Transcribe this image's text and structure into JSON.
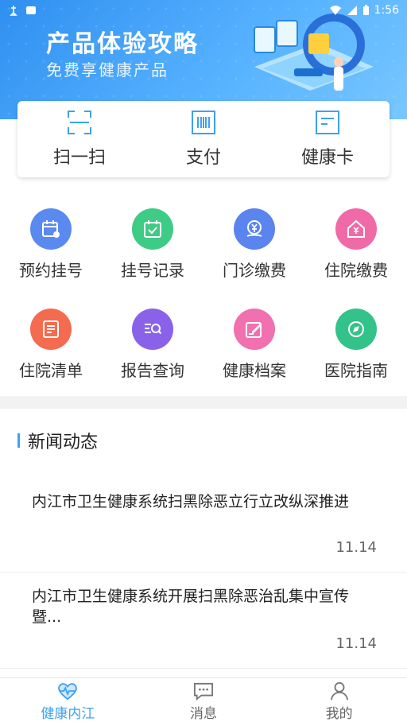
{
  "status_bar": {
    "time": "1:56"
  },
  "banner": {
    "title": "产品体验攻略",
    "subtitle": "免费享健康产品"
  },
  "quick_actions": [
    {
      "label": "扫一扫",
      "icon": "scan-icon"
    },
    {
      "label": "支付",
      "icon": "barcode-icon"
    },
    {
      "label": "健康卡",
      "icon": "card-icon"
    }
  ],
  "services": [
    {
      "label": "预约挂号",
      "icon": "calendar-icon",
      "color": "#5a8af0"
    },
    {
      "label": "挂号记录",
      "icon": "calendar-check-icon",
      "color": "#3ecb86"
    },
    {
      "label": "门诊缴费",
      "icon": "yen-coin-icon",
      "color": "#5a84ee"
    },
    {
      "label": "住院缴费",
      "icon": "yen-house-icon",
      "color": "#f06aa8"
    },
    {
      "label": "住院清单",
      "icon": "list-icon",
      "color": "#f56b4f"
    },
    {
      "label": "报告查询",
      "icon": "report-search-icon",
      "color": "#8a62ea"
    },
    {
      "label": "健康档案",
      "icon": "edit-record-icon",
      "color": "#f070b0"
    },
    {
      "label": "医院指南",
      "icon": "compass-icon",
      "color": "#33c28a"
    }
  ],
  "news": {
    "heading": "新闻动态",
    "items": [
      {
        "title": "内江市卫生健康系统扫黑除恶立行立改纵深推进",
        "date": "11.14"
      },
      {
        "title": "内江市卫生健康系统开展扫黑除恶治乱集中宣传暨...",
        "date": "11.14"
      }
    ]
  },
  "bottom_nav": [
    {
      "label": "健康内江",
      "icon": "heart-pulse-icon",
      "active": true
    },
    {
      "label": "消息",
      "icon": "message-icon",
      "active": false
    },
    {
      "label": "我的",
      "icon": "person-icon",
      "active": false
    }
  ],
  "colors": {
    "accent": "#3da1f4"
  }
}
